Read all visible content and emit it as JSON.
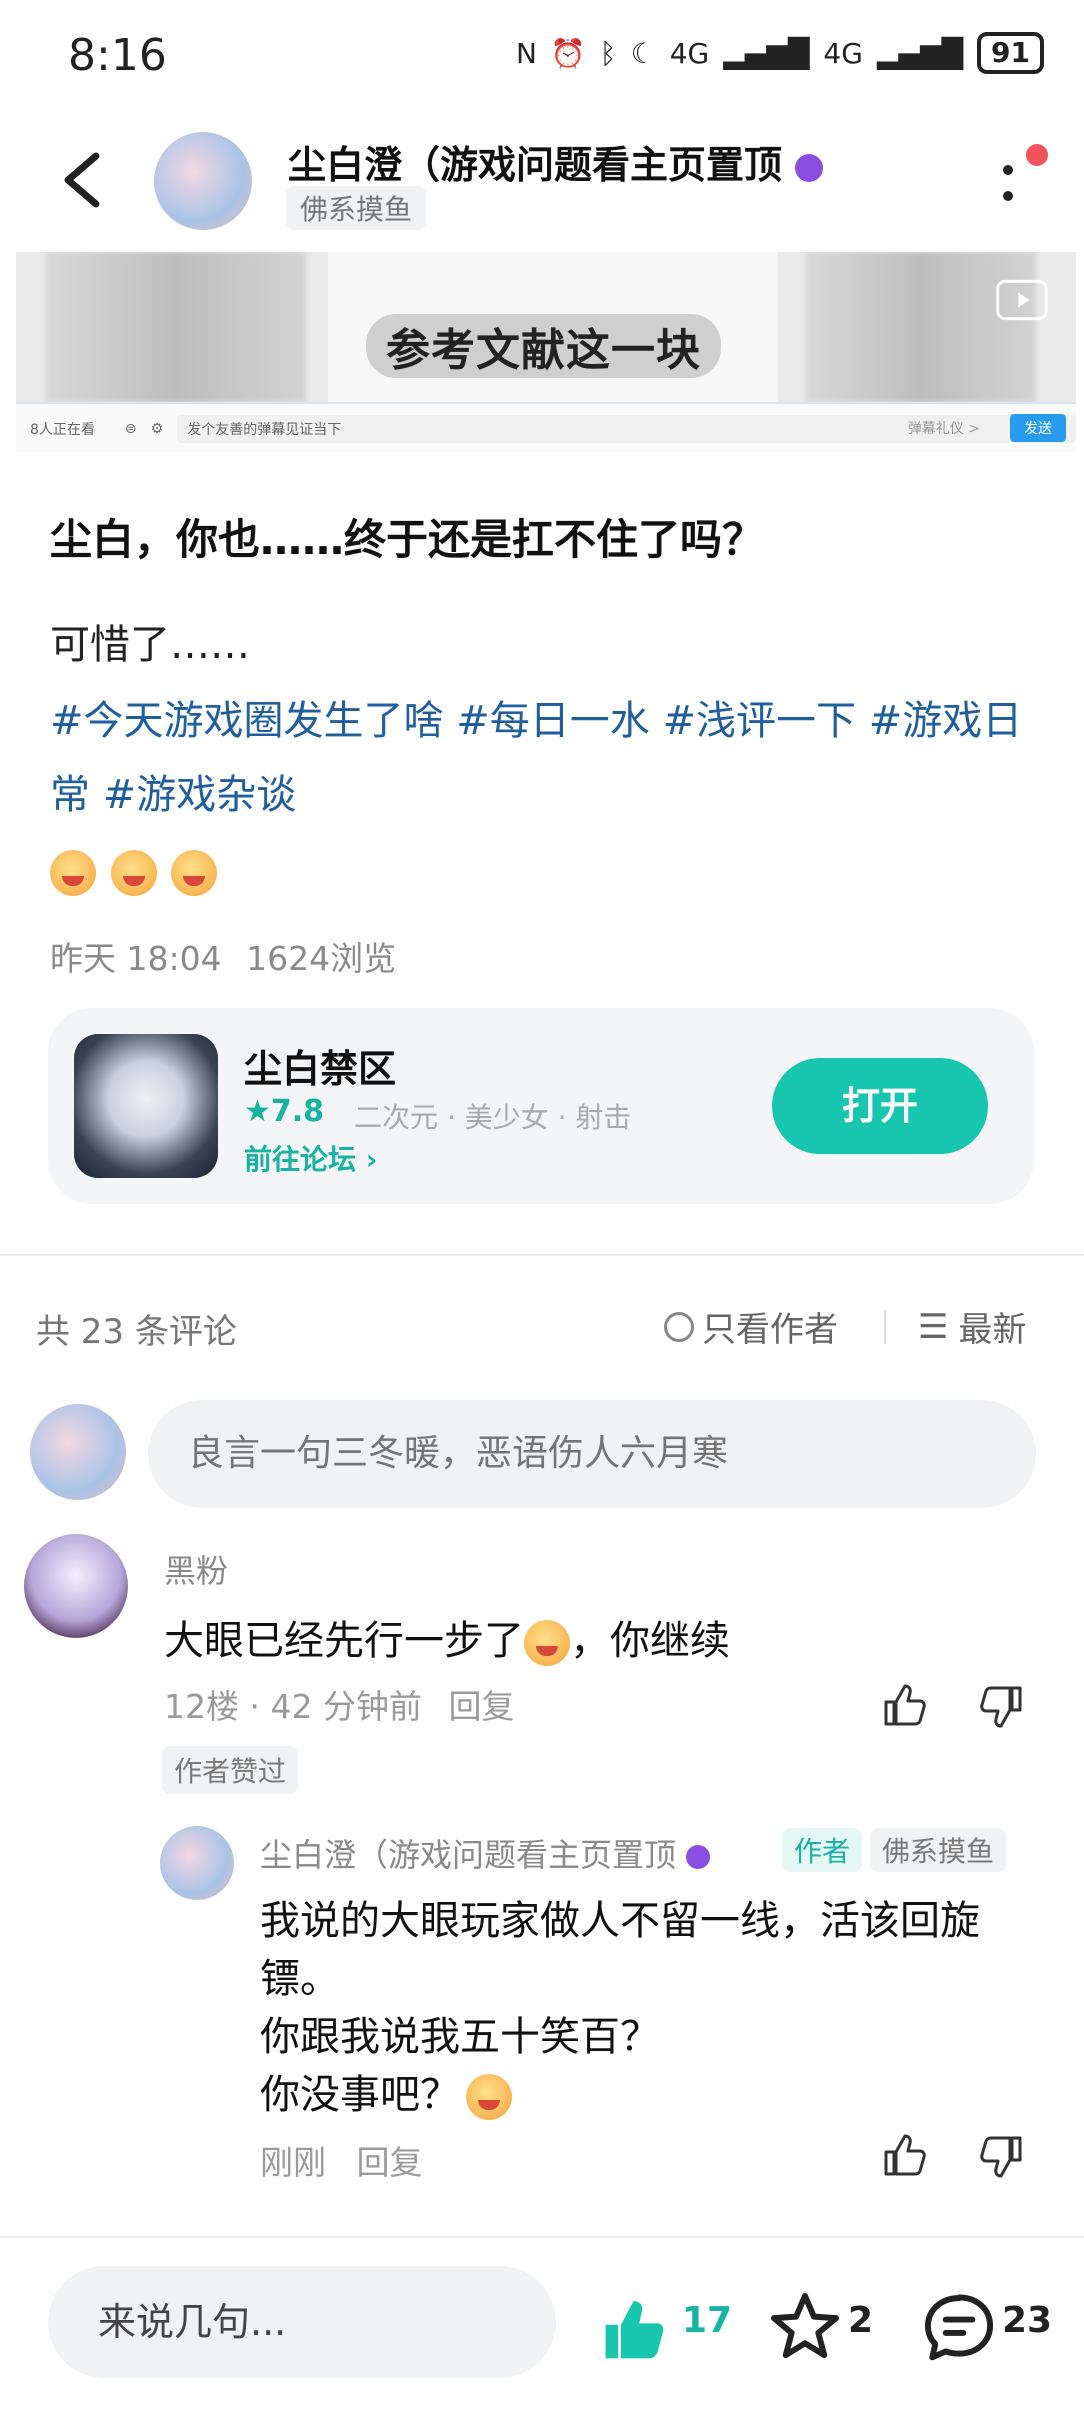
{
  "status_bar": {
    "time": "8:16",
    "network_left": "4G",
    "network_right": "4G",
    "battery": "91"
  },
  "header": {
    "title": "尘白澄（游戏问题看主页置顶",
    "tag": "佛系摸鱼"
  },
  "video": {
    "caption": "参考文献这一块",
    "viewers": "8人正在看",
    "danmaku_placeholder": "发个友善的弹幕见证当下",
    "danmaku_etiquette": "弹幕礼仪 >",
    "send_label": "发送"
  },
  "post": {
    "title": "尘白，你也……终于还是扛不住了吗？",
    "body": "可惜了……",
    "tags": "#今天游戏圈发生了啥 #每日一水 #浅评一下 #游戏日常 #游戏杂谈",
    "time": "昨天 18:04",
    "views": "1624浏览"
  },
  "game_card": {
    "name": "尘白禁区",
    "rating": "★7.8",
    "genre": "二次元 · 美少女 · 射击",
    "forum_link": "前往论坛 ›",
    "open_label": "打开"
  },
  "comments_header": {
    "count": "共 23 条评论",
    "only_author": "只看作者",
    "sort": "最新"
  },
  "comment_input": {
    "placeholder": "良言一句三冬暖，恶语伤人六月寒"
  },
  "comment1": {
    "user": "黑粉",
    "text_a": "大眼已经先行一步了",
    "text_b": "，你继续",
    "meta": "12楼 · 42 分钟前",
    "reply": "回复",
    "badge": "作者赞过"
  },
  "reply1": {
    "user": "尘白澄（游戏问题看主页置顶",
    "author_badge": "作者",
    "tag": "佛系摸鱼",
    "line1": "我说的大眼玩家做人不留一线，活该回旋镖。",
    "line2": "你跟我说我五十笑百？",
    "line3": "你没事吧？",
    "time": "刚刚",
    "reply": "回复"
  },
  "bottom_bar": {
    "input_placeholder": "来说几句...",
    "likes": "17",
    "stars": "2",
    "comments": "23"
  },
  "colors": {
    "accent": "#18c6b0",
    "hashtag": "#1f5f9e",
    "red_dot": "#f2545b"
  }
}
